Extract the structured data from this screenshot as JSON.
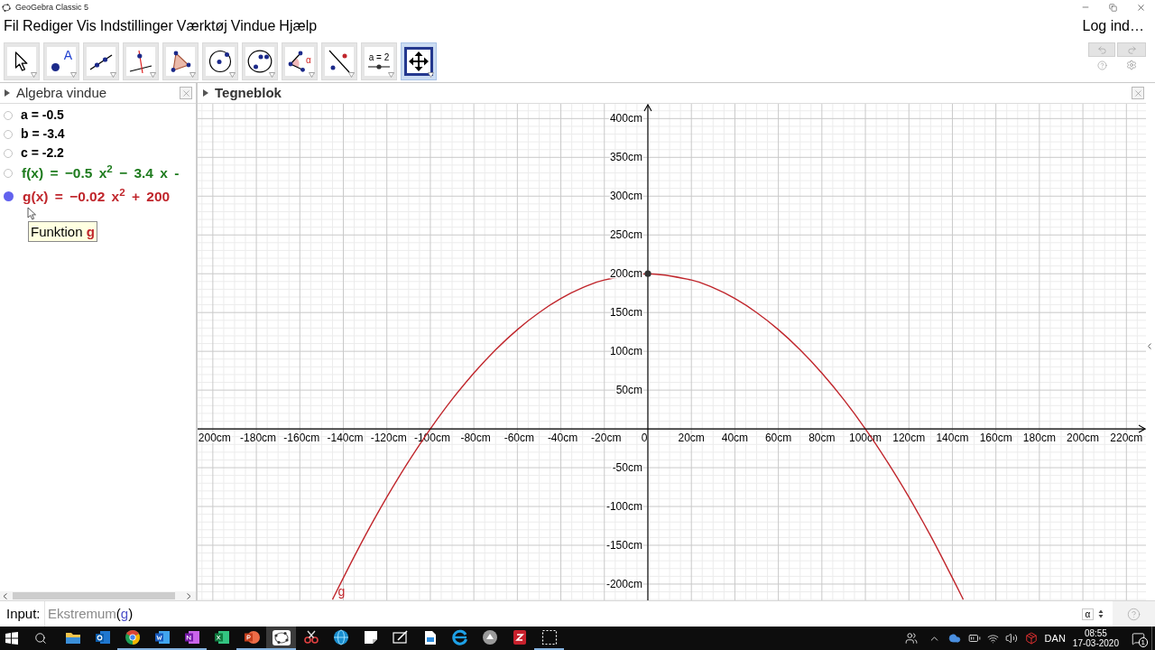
{
  "window": {
    "title": "GeoGebra Classic 5"
  },
  "menu": {
    "items": [
      "Fil",
      "Rediger",
      "Vis",
      "Indstillinger",
      "Værktøj",
      "Vindue",
      "Hjælp"
    ],
    "login": "Log ind…"
  },
  "toolbar": {
    "tools": [
      {
        "kind": "move",
        "selected": false
      },
      {
        "kind": "point",
        "label": "A",
        "selected": false
      },
      {
        "kind": "line",
        "selected": false
      },
      {
        "kind": "perpendicular",
        "selected": false
      },
      {
        "kind": "polygon",
        "selected": false
      },
      {
        "kind": "circlecenter",
        "selected": false
      },
      {
        "kind": "circlethree",
        "selected": false
      },
      {
        "kind": "angle",
        "label": "α",
        "selected": false
      },
      {
        "kind": "reflect",
        "selected": false
      },
      {
        "kind": "slider",
        "label": "a = 2",
        "selected": false
      },
      {
        "kind": "moveview",
        "selected": true
      }
    ]
  },
  "algebra": {
    "title": "Algebra vindue",
    "items": [
      {
        "kind": "number",
        "text": "a = -0.5",
        "shown": false,
        "color": "#000000"
      },
      {
        "kind": "number",
        "text": "b = -3.4",
        "shown": false,
        "color": "#000000"
      },
      {
        "kind": "number",
        "text": "c = -2.2",
        "shown": false,
        "color": "#000000"
      },
      {
        "kind": "function",
        "text": "f(x) = −0.5 x$^{2}$ − 3.4 x -",
        "shown": false,
        "color": "#1e7b1e"
      },
      {
        "kind": "function",
        "text": "g(x) = −0.02 x$^{2}$ + 200",
        "shown": true,
        "color": "#c0262c"
      }
    ],
    "tooltip": "Funktion **g**"
  },
  "graphics": {
    "title": "Tegneblok",
    "chart_data": [
      {
        "type": "line",
        "xlim": [
          -207,
          229
        ],
        "ylim": [
          -221,
          419
        ],
        "grid": true,
        "xticks": [
          {
            "value": -200,
            "label": "200cm"
          },
          {
            "value": -180,
            "label": "-180cm"
          },
          {
            "value": -160,
            "label": "-160cm"
          },
          {
            "value": -140,
            "label": "-140cm"
          },
          {
            "value": -120,
            "label": "-120cm"
          },
          {
            "value": -100,
            "label": "-100cm"
          },
          {
            "value": -80,
            "label": "-80cm"
          },
          {
            "value": -60,
            "label": "-60cm"
          },
          {
            "value": -40,
            "label": "-40cm"
          },
          {
            "value": -20,
            "label": "-20cm"
          },
          {
            "value": 0,
            "label": "0"
          },
          {
            "value": 20,
            "label": "20cm"
          },
          {
            "value": 40,
            "label": "40cm"
          },
          {
            "value": 60,
            "label": "60cm"
          },
          {
            "value": 80,
            "label": "80cm"
          },
          {
            "value": 100,
            "label": "100cm"
          },
          {
            "value": 120,
            "label": "120cm"
          },
          {
            "value": 140,
            "label": "140cm"
          },
          {
            "value": 160,
            "label": "160cm"
          },
          {
            "value": 180,
            "label": "180cm"
          },
          {
            "value": 200,
            "label": "200cm"
          },
          {
            "value": 220,
            "label": "220cm"
          }
        ],
        "yticks": [
          {
            "value": -200,
            "label": "-200cm"
          },
          {
            "value": -150,
            "label": "-150cm"
          },
          {
            "value": -100,
            "label": "-100cm"
          },
          {
            "value": -50,
            "label": "-50cm"
          },
          {
            "value": 50,
            "label": "50cm"
          },
          {
            "value": 100,
            "label": "100cm"
          },
          {
            "value": 150,
            "label": "150cm"
          },
          {
            "value": 200,
            "label": "200cm"
          },
          {
            "value": 250,
            "label": "250cm"
          },
          {
            "value": 300,
            "label": "300cm"
          },
          {
            "value": 350,
            "label": "350cm"
          },
          {
            "value": 400,
            "label": "400cm"
          }
        ],
        "series": [
          {
            "type": "line",
            "color": "#c0262c",
            "x": [
              -145,
              -140,
              -130,
              -120,
              -110,
              -100,
              -90,
              -80,
              -70,
              -60,
              -50,
              -40,
              -30,
              -20,
              0,
              20,
              30,
              40,
              50,
              60,
              70,
              80,
              90,
              100,
              110,
              120,
              130,
              140,
              145
            ],
            "values": [
              -220,
              -192,
              -138,
              -88,
              -42,
              0,
              38,
              72,
              102,
              128,
              150,
              168,
              182,
              192,
              200,
              192,
              182,
              168,
              150,
              128,
              102,
              72,
              38,
              0,
              -42,
              -88,
              -138,
              -192,
              -220
            ]
          },
          {
            "type": "scatter",
            "color": "#333333",
            "x": [
              0
            ],
            "values": [
              200
            ]
          }
        ],
        "annotations": [
          "g"
        ]
      }
    ]
  },
  "input_bar": {
    "label": "Input:",
    "segments": [
      {
        "kind": "command",
        "text": "Ekstremum"
      },
      {
        "kind": "plain",
        "text": "("
      },
      {
        "kind": "object",
        "text": "g"
      },
      {
        "kind": "plain",
        "text": ")"
      }
    ],
    "symbol_button": "α"
  },
  "taskbar": {
    "apps": [
      {
        "kind": "folder",
        "running": false,
        "selected": false
      },
      {
        "kind": "mailtile",
        "running": false,
        "selected": false
      },
      {
        "kind": "wheel",
        "running": true,
        "selected": false
      },
      {
        "kind": "wordtile",
        "running": true,
        "selected": false
      },
      {
        "kind": "notetile",
        "running": true,
        "selected": false
      },
      {
        "kind": "sheettile",
        "running": false,
        "selected": false
      },
      {
        "kind": "slidedisc",
        "running": true,
        "selected": false
      },
      {
        "kind": "ellipse",
        "running": true,
        "selected": true
      },
      {
        "kind": "scissors",
        "running": false,
        "selected": false
      },
      {
        "kind": "globe",
        "running": false,
        "selected": false
      },
      {
        "kind": "note",
        "running": false,
        "selected": false
      },
      {
        "kind": "pen",
        "running": false,
        "selected": false
      },
      {
        "kind": "image",
        "running": false,
        "selected": false
      },
      {
        "kind": "ering",
        "running": false,
        "selected": false
      },
      {
        "kind": "disc",
        "running": false,
        "selected": false
      },
      {
        "kind": "redtile",
        "running": false,
        "selected": false
      },
      {
        "kind": "dashed",
        "running": true,
        "selected": false
      }
    ],
    "language": "DAN",
    "time": "08:55",
    "date": "17-03-2020",
    "notifications": "1"
  }
}
